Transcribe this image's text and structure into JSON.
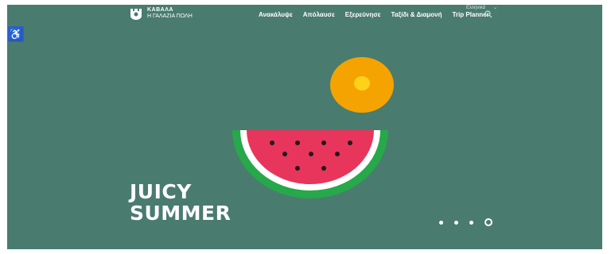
{
  "colors": {
    "background": "#4a7b6f",
    "accessibility": "#2f5fc8",
    "orange": "#f5a300",
    "orange_core": "#ffd21a",
    "melon_green": "#27a84a",
    "melon_red": "#e8355b"
  },
  "logo": {
    "title": "ΚΑΒΑΛΑ",
    "subtitle": "Η ΓΑΛΑΖΙΑ ΠΟΛΗ"
  },
  "language": {
    "label": "Ελληνικά",
    "chevron": "⌄"
  },
  "nav": {
    "items": [
      {
        "label": "Ανακάλυψε"
      },
      {
        "label": "Απόλαυσε"
      },
      {
        "label": "Εξερεύνησε"
      },
      {
        "label": "Ταξίδι & Διαμονή"
      },
      {
        "label": "Trip Planner"
      }
    ]
  },
  "accessibility": {
    "icon": "wheelchair-icon",
    "glyph": "♿"
  },
  "hero": {
    "line1": "JUICY",
    "line2": "SUMMER"
  },
  "slider": {
    "count": 4,
    "active_index": 3
  }
}
